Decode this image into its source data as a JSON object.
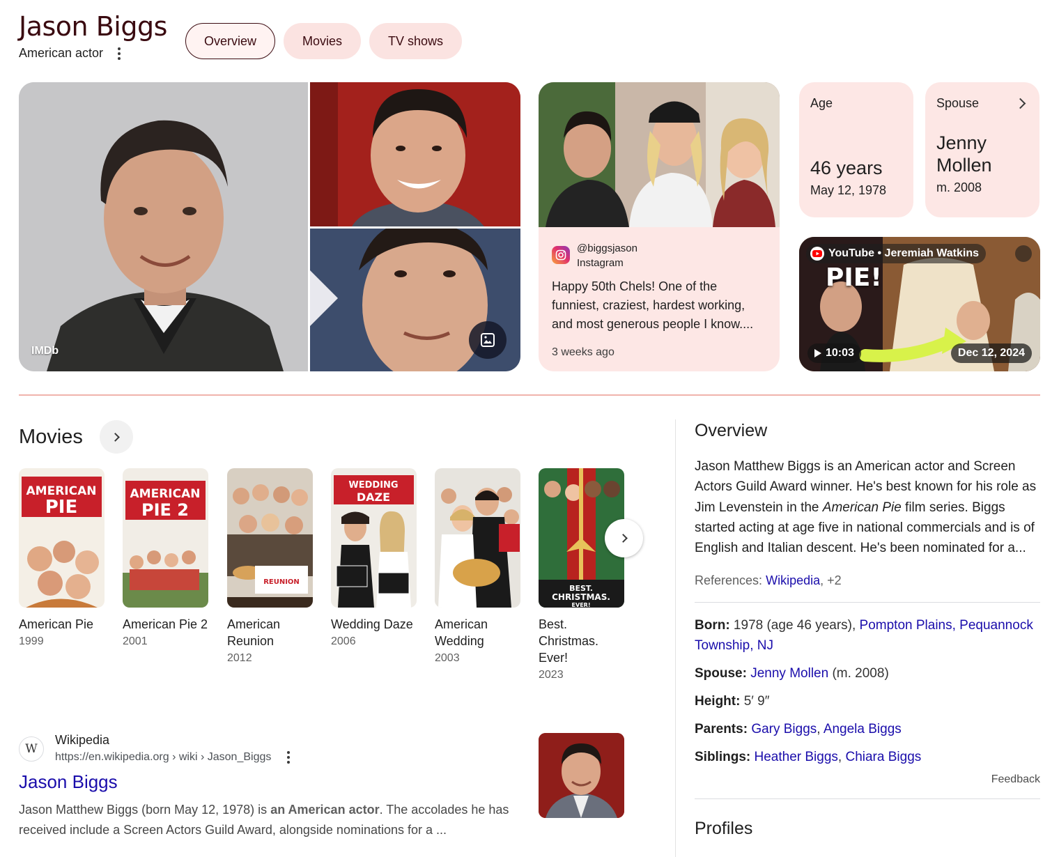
{
  "header": {
    "name": "Jason Biggs",
    "subtitle": "American actor"
  },
  "tabs": [
    {
      "label": "Overview",
      "active": true
    },
    {
      "label": "Movies",
      "active": false
    },
    {
      "label": "TV shows",
      "active": false
    }
  ],
  "images": {
    "main_source": "IMDb"
  },
  "instagram": {
    "handle": "@biggsjason",
    "platform": "Instagram",
    "text": "Happy 50th Chels! One of the funniest, craziest, hardest working, and most generous people I know....",
    "time": "3 weeks ago"
  },
  "age_card": {
    "label": "Age",
    "value": "46 years",
    "date": "May 12, 1978"
  },
  "spouse_card": {
    "label": "Spouse",
    "value": "Jenny Mollen",
    "date": "m. 2008"
  },
  "youtube": {
    "source": "YouTube • Jeremiah Watkins",
    "duration": "10:03",
    "date": "Dec 12, 2024",
    "overlay_text": "PIE!"
  },
  "movies": {
    "title": "Movies",
    "items": [
      {
        "name": "American Pie",
        "year": "1999",
        "poster_text": "AMERICAN PIE",
        "color": "#c8202a"
      },
      {
        "name": "American Pie 2",
        "year": "2001",
        "poster_text": "AMERICAN PIE 2",
        "color": "#c8202a"
      },
      {
        "name": "American Reunion",
        "year": "2012",
        "poster_text": "AMERICAN REUNION",
        "color": "#7a5a3a"
      },
      {
        "name": "Wedding Daze",
        "year": "2006",
        "poster_text": "WEDDING DAZE",
        "color": "#c8202a"
      },
      {
        "name": "American Wedding",
        "year": "2003",
        "poster_text": "AMERICAN WEDDING",
        "color": "#3b3b3b"
      },
      {
        "name": "Best. Christmas. Ever!",
        "year": "2023",
        "poster_text": "BEST. CHRISTMAS. EVER!",
        "color": "#2f6e3a"
      }
    ]
  },
  "wiki_result": {
    "site": "Wikipedia",
    "url": "https://en.wikipedia.org › wiki › Jason_Biggs",
    "title": "Jason Biggs",
    "snippet_pre": "Jason Matthew Biggs (born May 12, 1978) is ",
    "snippet_bold": "an American actor",
    "snippet_post": ". The accolades he has received include a Screen Actors Guild Award, alongside nominations for a ..."
  },
  "overview": {
    "heading": "Overview",
    "desc_1": "Jason Matthew Biggs is an American actor and Screen Actors Guild Award winner. He's best known for his role as Jim Levenstein in the ",
    "desc_italic": "American Pie",
    "desc_2": " film series. Biggs started acting at age five in national commercials and is of English and Italian descent. He's been nominated for a...",
    "references_label": "References:",
    "references_link": "Wikipedia",
    "references_more": ", +2",
    "born_label": "Born:",
    "born_value": " 1978 (age 46 years), ",
    "born_place": "Pompton Plains, Pequannock Township, NJ",
    "spouse_label": "Spouse:",
    "spouse_link": "Jenny Mollen",
    "spouse_value": " (m. 2008)",
    "height_label": "Height:",
    "height_value": " 5′ 9″",
    "parents_label": "Parents:",
    "parent_1": "Gary Biggs",
    "parent_2": "Angela Biggs",
    "siblings_label": "Siblings:",
    "sibling_1": "Heather Biggs",
    "sibling_2": "Chiara Biggs",
    "separator": ", ",
    "feedback": "Feedback",
    "profiles": "Profiles"
  }
}
